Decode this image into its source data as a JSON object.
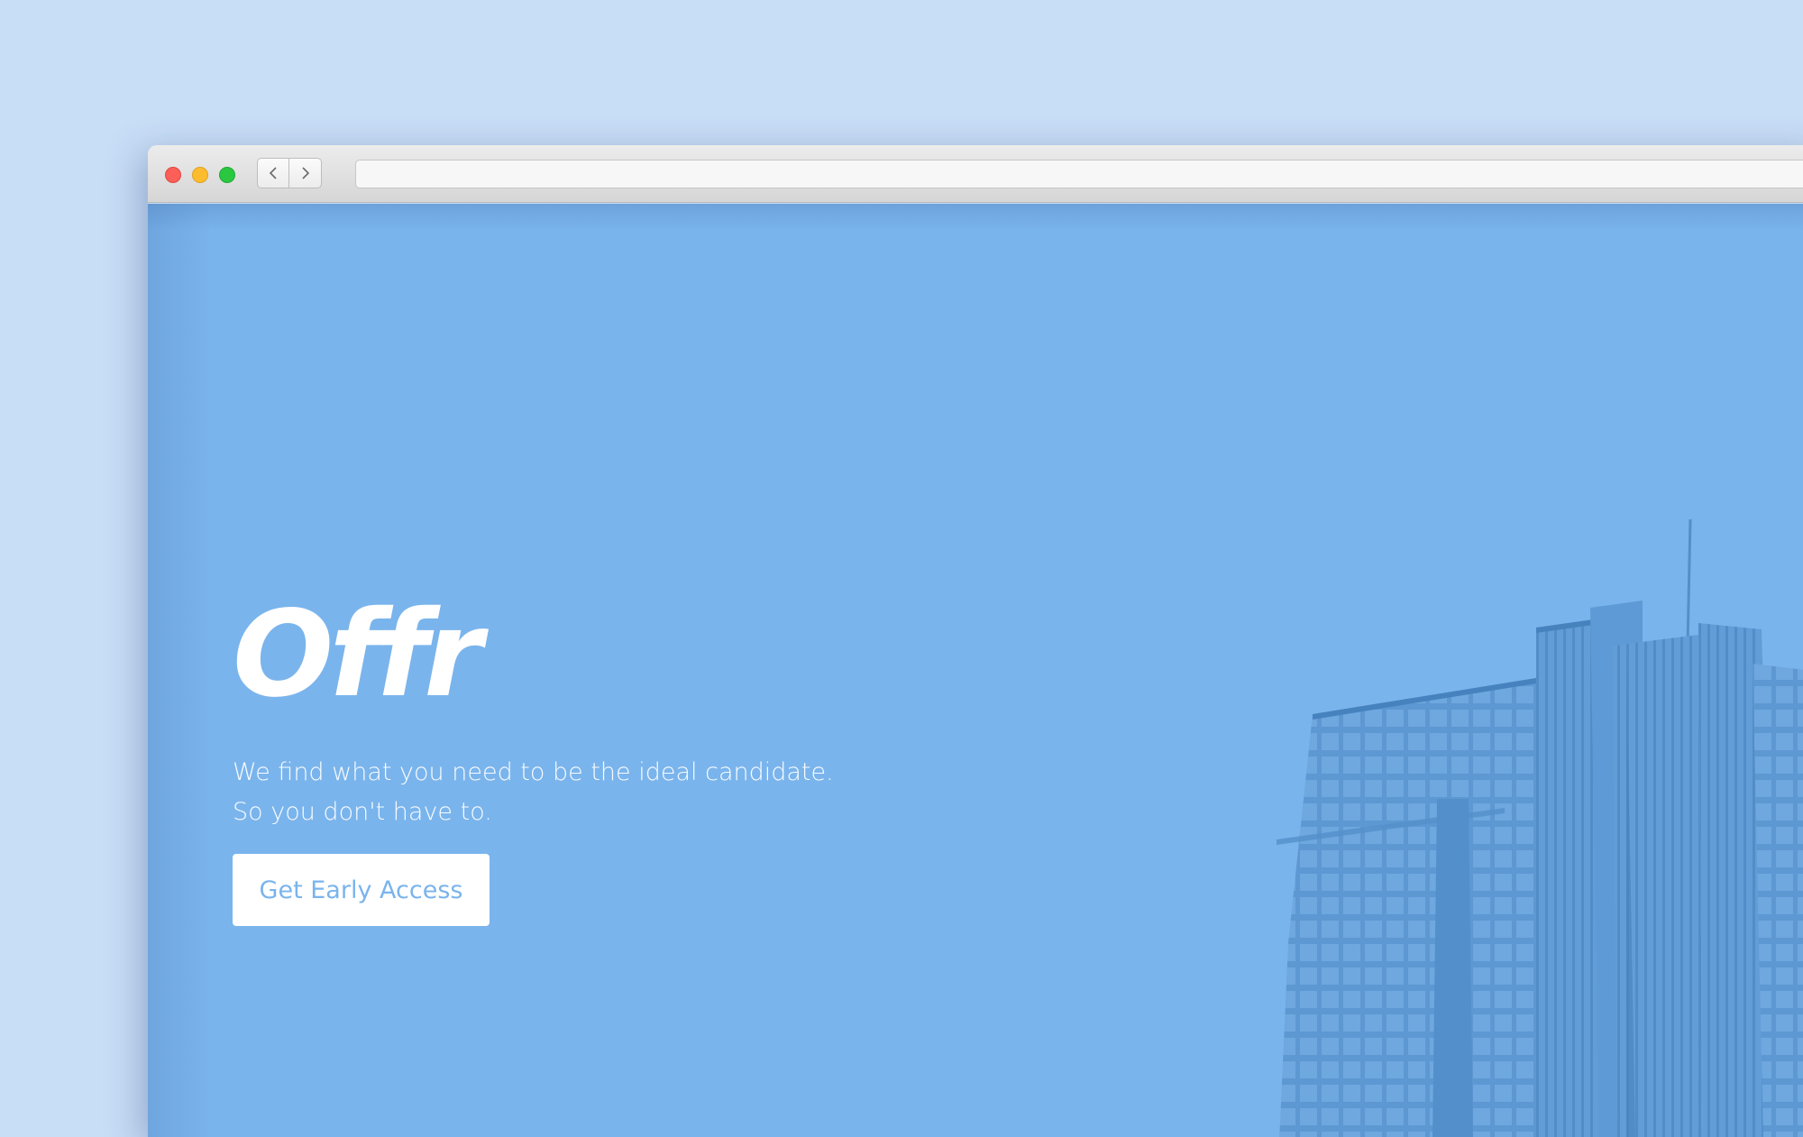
{
  "window": {
    "title": "",
    "address": ""
  },
  "hero": {
    "logo": "Offr",
    "tagline_line1": "We find what you need to be the ideal candidate.",
    "tagline_line2": "So you don't have to.",
    "cta_label": "Get Early Access"
  },
  "colors": {
    "page_background": "#c8ddf6",
    "hero_background": "#7ab4ec",
    "cta_text": "#7ab4ec",
    "traffic_red": "#fb5f57",
    "traffic_yellow": "#fdbc2e",
    "traffic_green": "#2ac840"
  },
  "icons": [
    "close-light-icon",
    "minimize-light-icon",
    "zoom-light-icon",
    "chevron-left-icon",
    "chevron-right-icon",
    "building-illustration"
  ]
}
